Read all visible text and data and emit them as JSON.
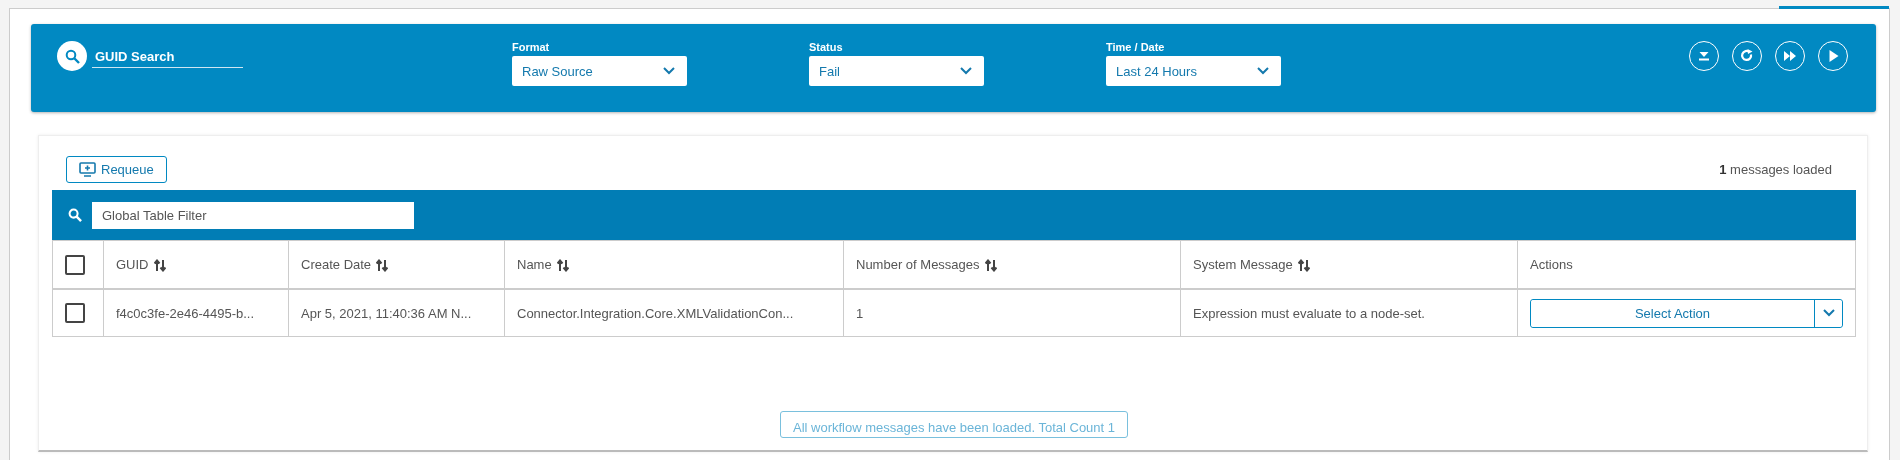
{
  "search": {
    "placeholder": "GUID Search"
  },
  "filters": [
    {
      "label": "Format",
      "value": "Raw Source"
    },
    {
      "label": "Status",
      "value": "Fail"
    },
    {
      "label": "Time / Date",
      "value": "Last 24 Hours"
    }
  ],
  "toolbar_icons": [
    {
      "kind": "download"
    },
    {
      "kind": "refresh"
    },
    {
      "kind": "fast-forward"
    },
    {
      "kind": "play"
    }
  ],
  "requeue_button": "Requeue",
  "loaded_summary": "**1** messages loaded",
  "table_filter": {
    "placeholder": "Global Table Filter"
  },
  "table": {
    "select_all": {
      "checked": false
    },
    "columns": [
      {
        "label": "GUID",
        "sortable": true
      },
      {
        "label": "Create Date",
        "sortable": true
      },
      {
        "label": "Name",
        "sortable": true
      },
      {
        "label": "Number of Messages",
        "sortable": true
      },
      {
        "label": "System Message",
        "sortable": true
      },
      {
        "label": "Actions",
        "sortable": false
      }
    ],
    "rows": [
      {
        "checked": false,
        "cells": [
          "f4c0c3fe-2e46-4495-b...",
          "Apr 5, 2021, 11:40:36 AM N...",
          "Connector.Integration.Core.XMLValidationCon...",
          "1",
          "Expression must evaluate to a node-set."
        ],
        "action": "Select Action"
      }
    ]
  },
  "footer_message": "All workflow messages have been loaded. Total Count 1"
}
